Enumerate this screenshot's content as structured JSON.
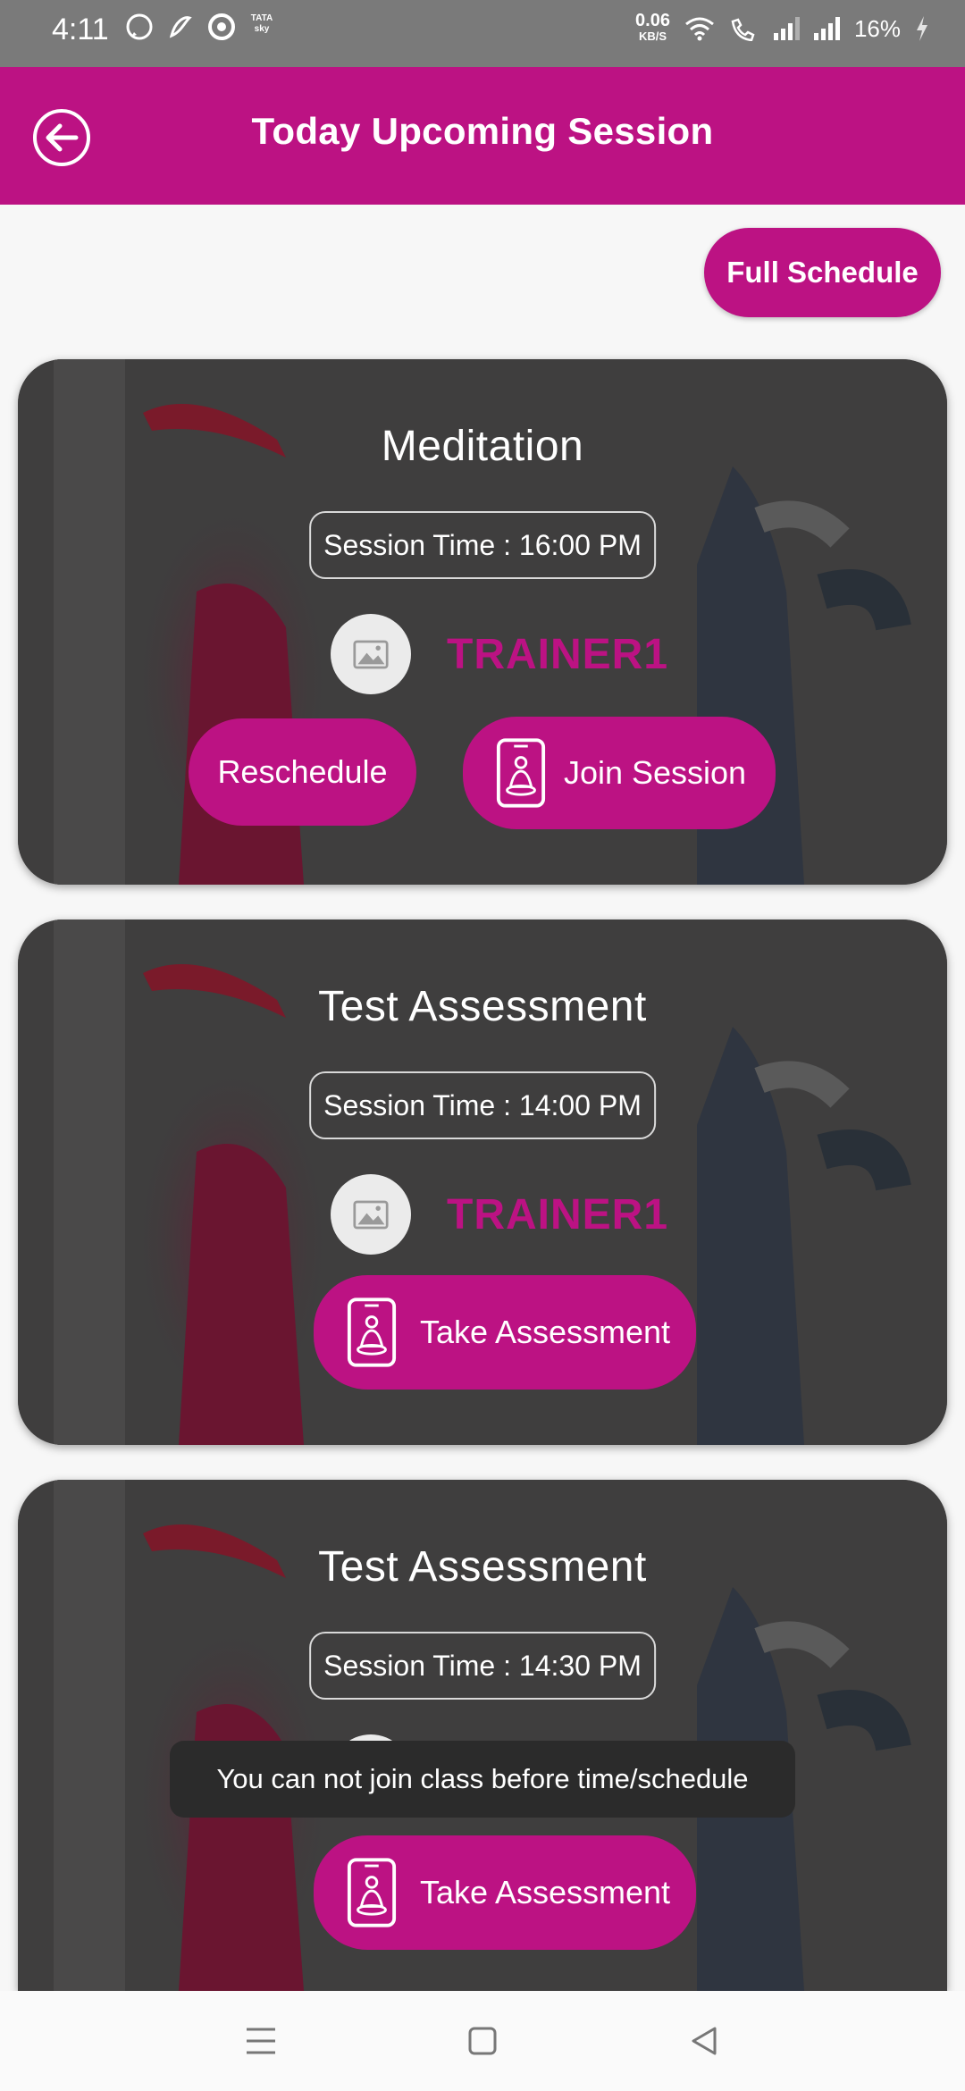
{
  "status_bar": {
    "time": "4:11",
    "data_speed_value": "0.06",
    "data_speed_unit": "KB/S",
    "battery": "16%",
    "left_icons": [
      "whatsapp-icon",
      "app-icon",
      "circle-app-icon",
      "tata-sky-icon"
    ],
    "tata_sky_label": "TATA sky"
  },
  "app_bar": {
    "title": "Today Upcoming Session",
    "background": "#bc1283"
  },
  "full_schedule_label": "Full Schedule",
  "sessions": [
    {
      "title": "Meditation",
      "session_time": "Session Time : 16:00 PM",
      "trainer": "TRAINER1",
      "reschedule_label": "Reschedule",
      "action_label": "Join Session"
    },
    {
      "title": "Test Assessment",
      "session_time": "Session Time : 14:00 PM",
      "trainer": "TRAINER1",
      "action_label": "Take Assessment"
    },
    {
      "title": "Test Assessment",
      "session_time": "Session Time : 14:30 PM",
      "trainer": "",
      "action_label": "Take Assessment"
    }
  ],
  "toast": "You can not join class before time/schedule",
  "colors": {
    "accent": "#bc1283",
    "status_bar": "#7a7a7a"
  },
  "nav": [
    "menu-icon",
    "home-icon",
    "back-triangle-icon"
  ]
}
